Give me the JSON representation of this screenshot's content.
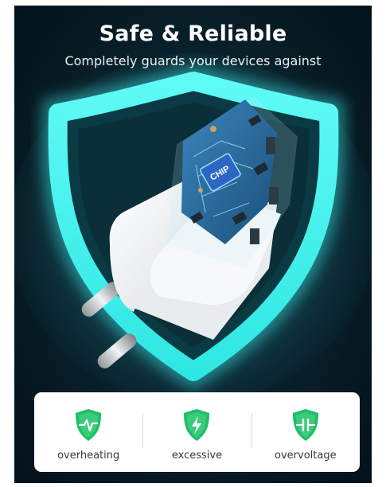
{
  "header": {
    "title": "Safe & Reliable",
    "subtitle": "Completely guards your devices against"
  },
  "product": {
    "chip_label": "CHIP",
    "shield_glow_color": "#3ff3f0",
    "shield_inner_color": "#0a3b44",
    "charger_color": "#f4f5f6",
    "board_color": "#2a6ea0"
  },
  "features": [
    {
      "label": "overheating",
      "icon": "shield-heartbeat-icon"
    },
    {
      "label": "excessive",
      "icon": "shield-lightning-icon"
    },
    {
      "label": "overvoltage",
      "icon": "shield-capacitor-icon"
    }
  ],
  "colors": {
    "feature_icon_green": "#1fbf6a",
    "feature_icon_light": "#6fe39f"
  }
}
